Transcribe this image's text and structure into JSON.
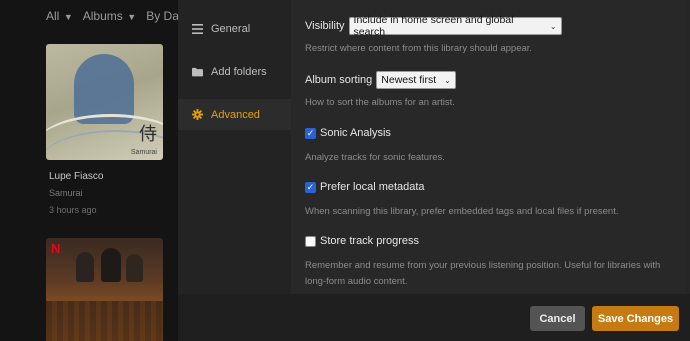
{
  "library": {
    "filters": {
      "type": "All",
      "view": "Albums",
      "sort": "By Date"
    },
    "albums": [
      {
        "artist": "Lupe Fiasco",
        "title": "Samurai",
        "added": "3 hours ago",
        "cover_text": "侍",
        "cover_brand": "Samurai"
      },
      {
        "badge": "N"
      }
    ]
  },
  "settings": {
    "nav": [
      {
        "label": "General",
        "icon": "list-icon"
      },
      {
        "label": "Add folders",
        "icon": "folder-icon"
      },
      {
        "label": "Advanced",
        "icon": "gear-icon",
        "active": true
      }
    ],
    "visibility": {
      "label": "Visibility",
      "value": "Include in home screen and global search",
      "help": "Restrict where content from this library should appear."
    },
    "album_sorting": {
      "label": "Album sorting",
      "value": "Newest first",
      "help": "How to sort the albums for an artist."
    },
    "sonic_analysis": {
      "label": "Sonic Analysis",
      "checked": true,
      "help": "Analyze tracks for sonic features."
    },
    "prefer_local_metadata": {
      "label": "Prefer local metadata",
      "checked": true,
      "help": "When scanning this library, prefer embedded tags and local files if present."
    },
    "store_track_progress": {
      "label": "Store track progress",
      "checked": false,
      "help_line1": "Remember and resume from your previous listening position. Useful for libraries with",
      "help_line2": "long-form audio content."
    },
    "buttons": {
      "cancel": "Cancel",
      "save": "Save Changes"
    },
    "colors": {
      "accent": "#e5a00d",
      "save": "#c57b12",
      "checkbox": "#2a62d6"
    }
  }
}
